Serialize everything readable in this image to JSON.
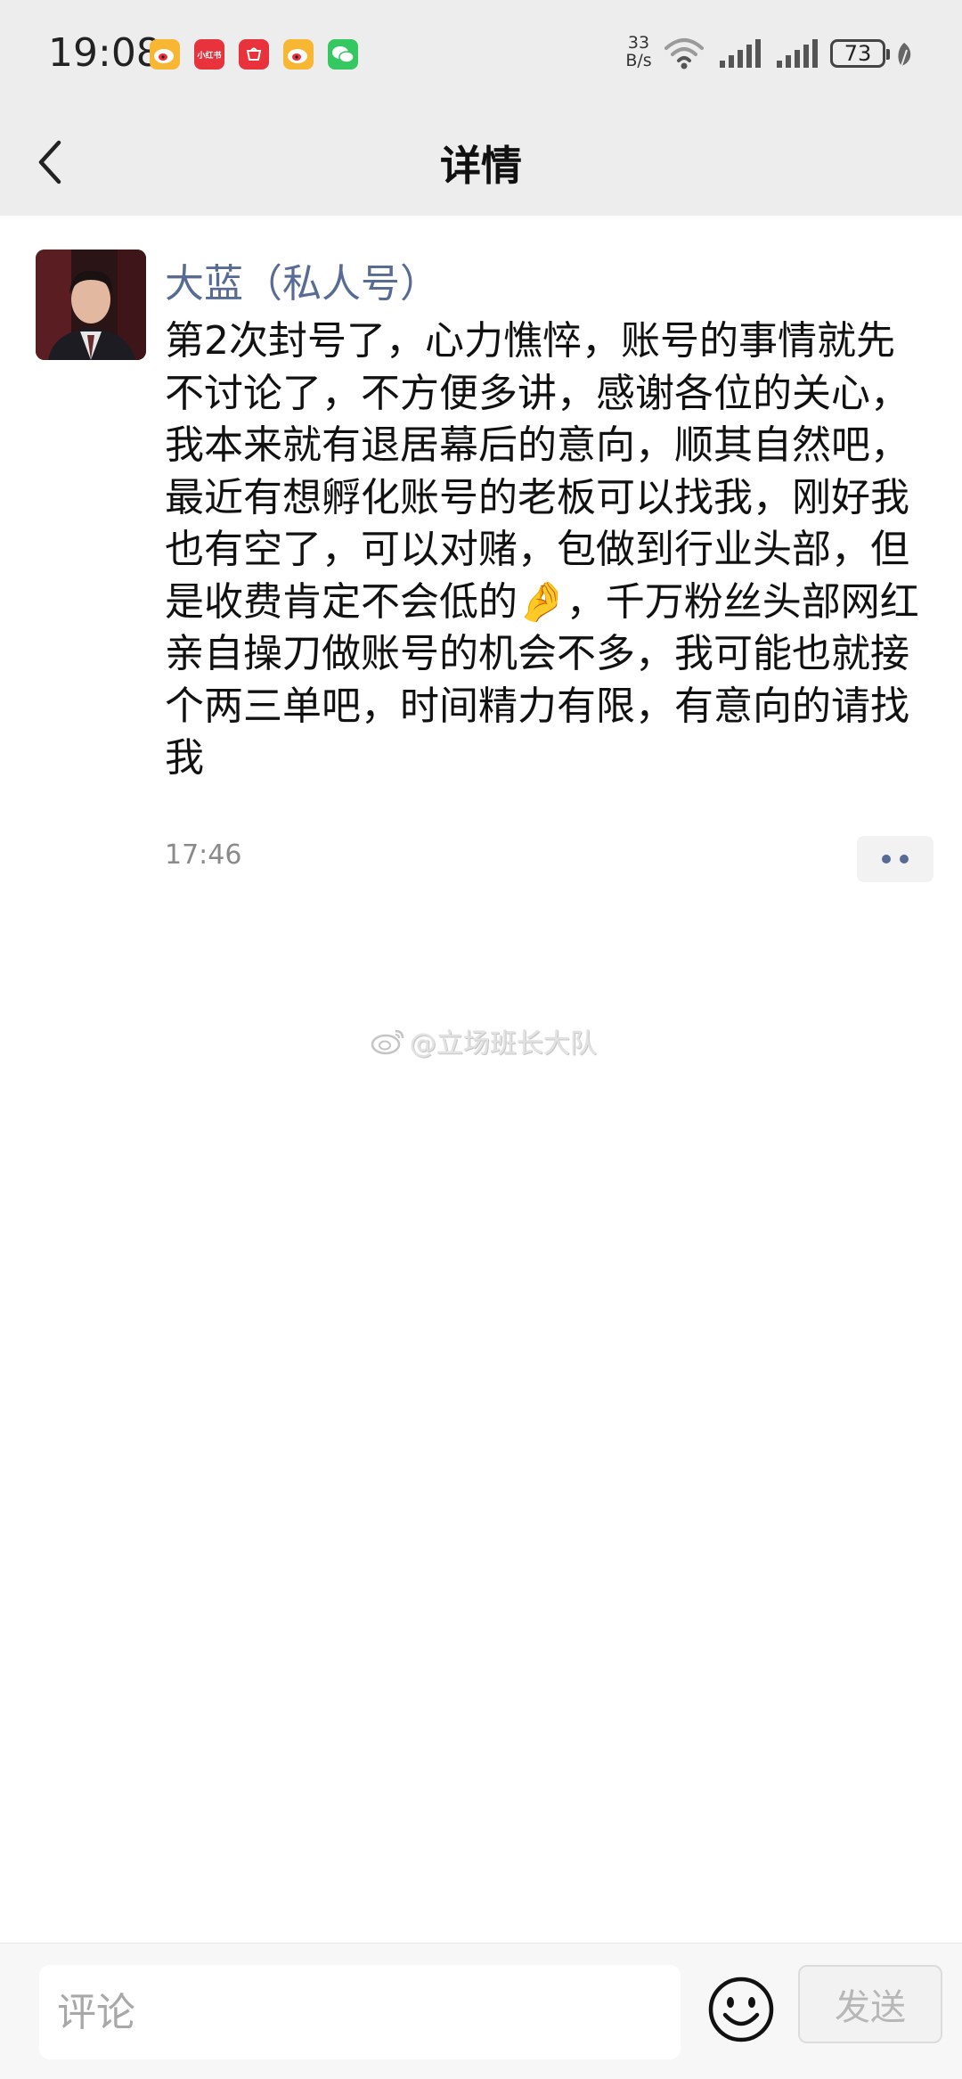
{
  "status_bar": {
    "time": "19:08",
    "app_icons": [
      "weibo-icon",
      "xiaohongshu-icon",
      "huawei-mall-icon",
      "weibo-icon",
      "wechat-icon"
    ],
    "xiaohongshu_label": "小红书",
    "net_speed_value": "33",
    "net_speed_unit": "B/s",
    "battery": "73"
  },
  "header": {
    "title": "详情",
    "back_icon": "chevron-left-icon"
  },
  "post": {
    "author": "大蓝（私人号）",
    "body": "第2次封号了，心力憔悴，账号的事情就先不讨论了，不方便多讲，感谢各位的关心，我本来就有退居幕后的意向，顺其自然吧，最近有想孵化账号的老板可以找我，刚好我也有空了，可以对赌，包做到行业头部，但是收费肯定不会低的🤌，千万粉丝头部网红亲自操刀做账号的机会不多，我可能也就接个两三单吧，时间精力有限，有意向的请找我",
    "time": "17:46",
    "more_icon": "more-dots-icon"
  },
  "watermark": {
    "text": "@立场班长大队"
  },
  "comment_bar": {
    "placeholder": "评论",
    "emoji_icon": "smiley-icon",
    "send_label": "发送"
  },
  "colors": {
    "author_link": "#576b95",
    "header_bg": "#ededed",
    "page_bg": "#ffffff"
  }
}
